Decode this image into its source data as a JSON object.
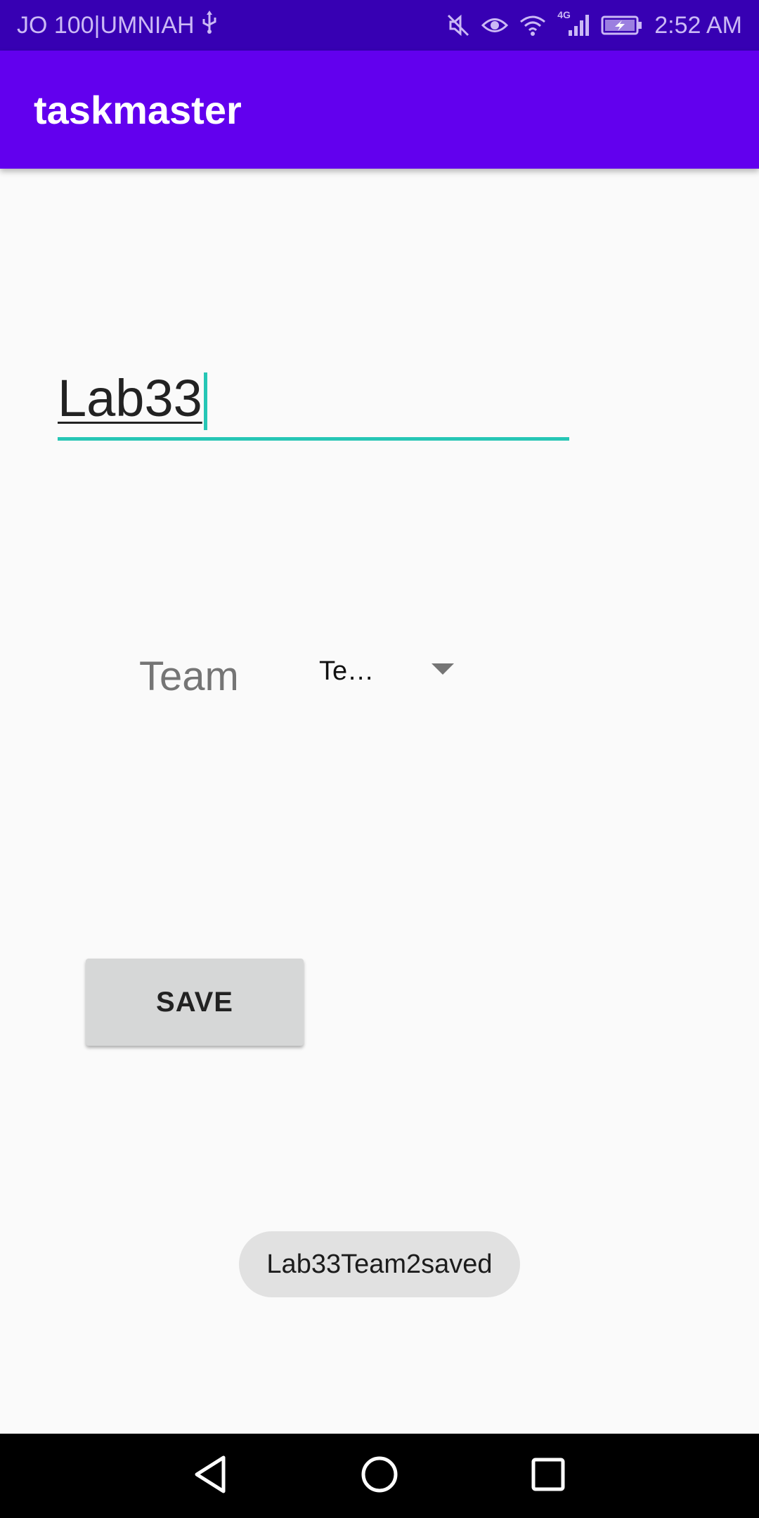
{
  "status_bar": {
    "carrier": "JO 100|UMNIAH",
    "time": "2:52 AM",
    "network_type": "4G",
    "icons": [
      "usb-icon",
      "mute-icon",
      "eye-icon",
      "wifi-icon",
      "signal-icon",
      "battery-icon"
    ]
  },
  "app_bar": {
    "title": "taskmaster"
  },
  "task_field": {
    "value": "Lab33"
  },
  "team": {
    "label": "Team",
    "selected_value": "Te…"
  },
  "save_button": {
    "label": "SAVE"
  },
  "toast": {
    "message": "Lab33Team2saved"
  },
  "nav_bar": {
    "icons": [
      "back-icon",
      "home-icon",
      "recents-icon"
    ]
  },
  "colors": {
    "status_bar": "#3700b3",
    "app_bar": "#6200ee",
    "accent": "#26c6b5",
    "background": "#fafafa",
    "button": "#d6d7d7",
    "toast": "#e1e1e1"
  }
}
